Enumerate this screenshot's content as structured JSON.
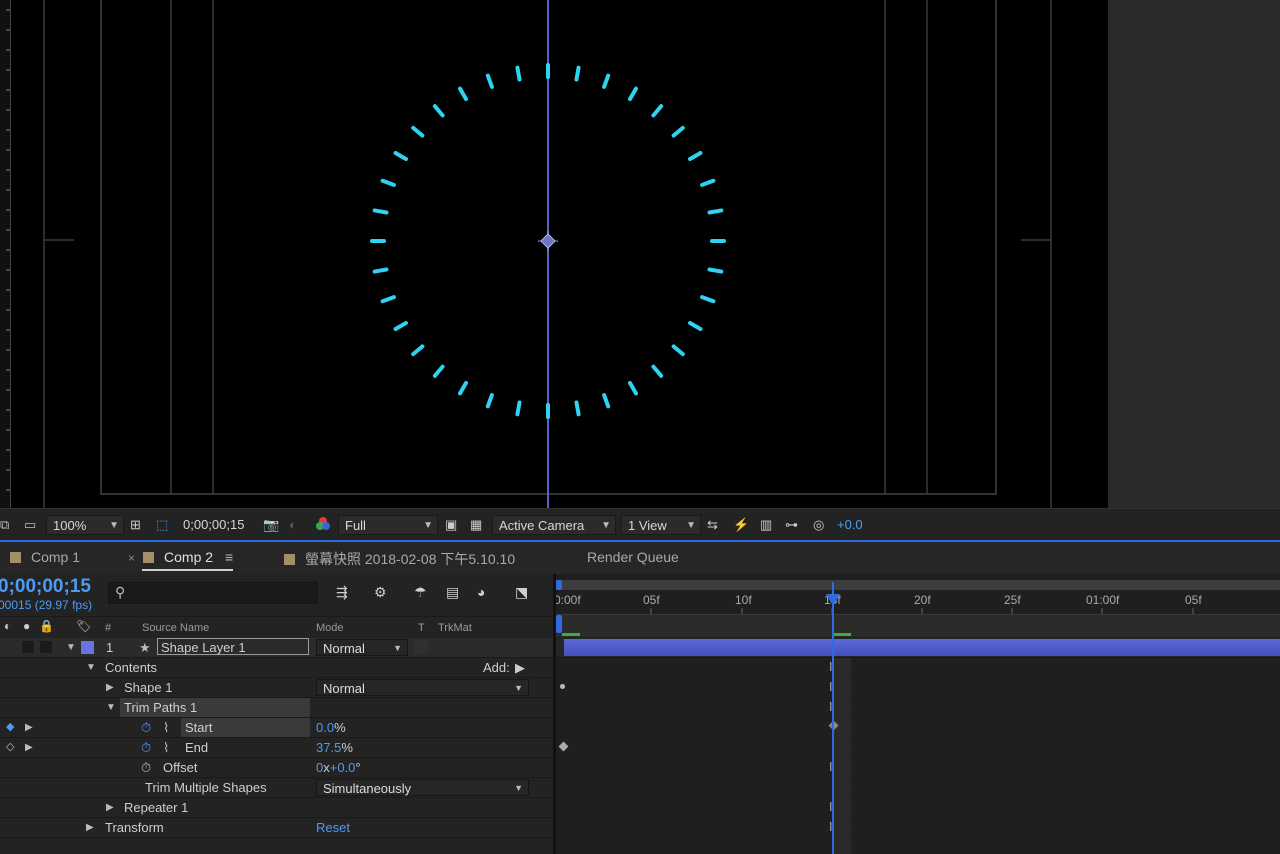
{
  "viewer_bar": {
    "zoom": "100%",
    "timecode": "0;00;00;15",
    "resolution": "Full",
    "camera": "Active Camera",
    "views": "1 View",
    "exposure": "+0.0"
  },
  "tabs": [
    {
      "label": "Comp 1"
    },
    {
      "label": "Comp 2"
    },
    {
      "label": "螢幕快照 2018-02-08 下午5.10.10"
    },
    {
      "label": "Render Queue"
    }
  ],
  "timeline": {
    "timecode": "0;00;00;15",
    "frame_info": "00015 (29.97 fps)",
    "search_placeholder": "",
    "columns": {
      "number": "#",
      "source_name": "Source Name",
      "mode": "Mode",
      "t": "T",
      "trkmat": "TrkMat"
    },
    "ruler_labels": [
      "0:00f",
      "05f",
      "10f",
      "15f",
      "20f",
      "25f",
      "01:00f",
      "05f"
    ]
  },
  "layer": {
    "number": "1",
    "name": "Shape Layer 1",
    "mode": "Normal",
    "contents_label": "Contents",
    "add_label": "Add:",
    "shape_label": "Shape 1",
    "shape_mode": "Normal",
    "trim_label": "Trim Paths 1",
    "start_label": "Start",
    "start_value": "0.0",
    "start_unit": "%",
    "end_label": "End",
    "end_value": "37.5",
    "end_unit": "%",
    "offset_label": "Offset",
    "offset_rev": "0",
    "offset_x": "x",
    "offset_deg": "+0.0",
    "offset_unit": "°",
    "trim_multi_label": "Trim Multiple Shapes",
    "trim_multi_value": "Simultaneously",
    "repeater_label": "Repeater 1",
    "transform_label": "Transform",
    "reset_label": "Reset"
  },
  "colors": {
    "accent_blue": "#4a9cf5",
    "tick_cyan": "#2ed3f0",
    "layer_bar": "#4d5bcf",
    "label_tan": "#a88d6b",
    "layer_label": "#6675e0"
  }
}
